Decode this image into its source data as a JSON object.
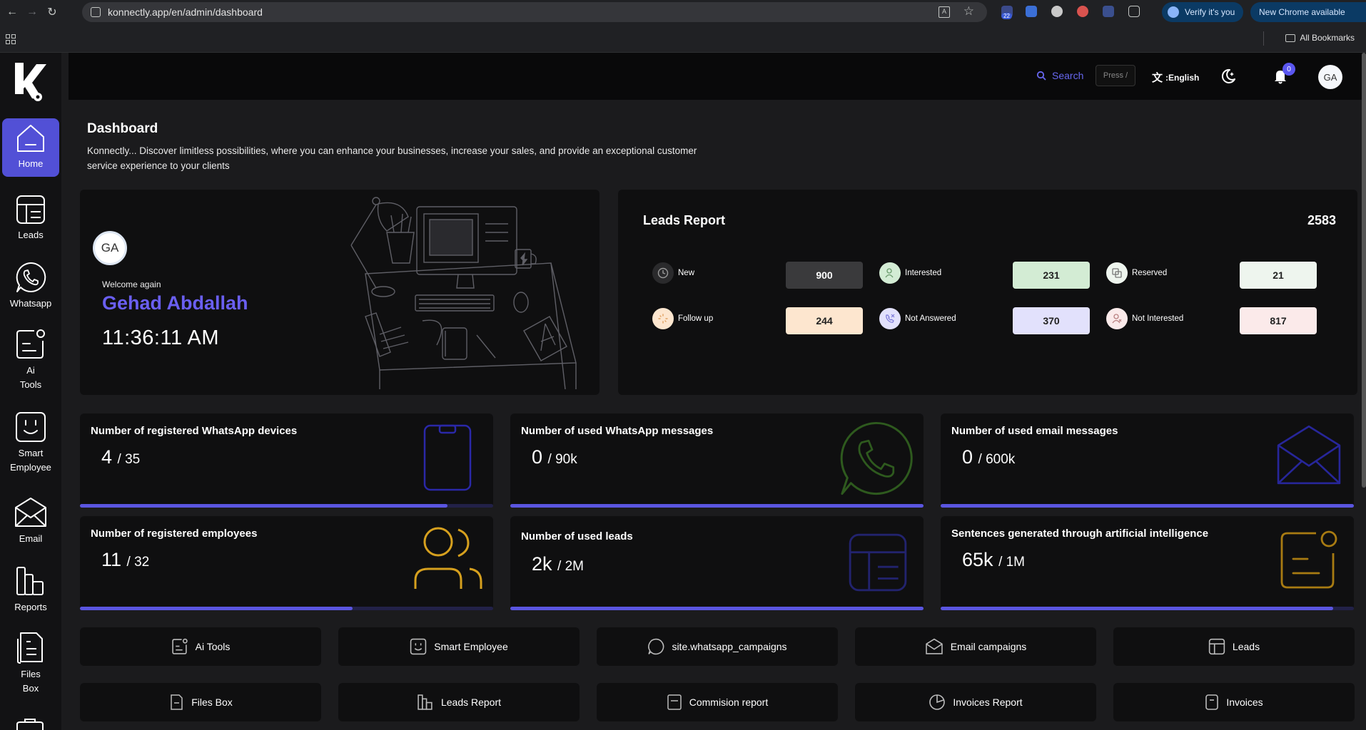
{
  "browser": {
    "url": "konnectly.app/en/admin/dashboard",
    "ext_badge": "22",
    "verify_label": "Verify it's you",
    "update_label": "New Chrome available",
    "bookmarks_label": "All Bookmarks"
  },
  "sidebar": {
    "items": [
      {
        "label": "Home",
        "icon": "home-icon",
        "active": true
      },
      {
        "label": "Leads",
        "icon": "table-icon"
      },
      {
        "label": "Whatsapp",
        "icon": "whatsapp-icon"
      },
      {
        "label": "Ai Tools",
        "icon": "ai-note-icon"
      },
      {
        "label": "Smart Employee",
        "icon": "smile-box-icon"
      },
      {
        "label": "Email",
        "icon": "envelope-icon"
      },
      {
        "label": "Reports",
        "icon": "bar-chart-icon"
      },
      {
        "label": "Files Box",
        "icon": "files-icon"
      }
    ]
  },
  "topbar": {
    "search_label": "Search",
    "search_shortcut": "Press /",
    "language": ":English",
    "notification_count": "0",
    "avatar_initials": "GA"
  },
  "page": {
    "title": "Dashboard",
    "description": "Konnectly... Discover limitless possibilities, where you can enhance your businesses, increase your sales, and provide an exceptional customer service experience to your clients"
  },
  "welcome": {
    "avatar_initials": "GA",
    "greeting": "Welcome again",
    "name": "Gehad Abdallah",
    "time": "11:36:11 AM"
  },
  "leads_report": {
    "title": "Leads Report",
    "total": "2583",
    "items": [
      {
        "label": "New",
        "value": "900",
        "color": "#3a3a3c",
        "text_color": "#ffffff"
      },
      {
        "label": "Interested",
        "value": "231",
        "color": "#d3ecd4",
        "text_color": "#222222"
      },
      {
        "label": "Reserved",
        "value": "21",
        "color": "#eef5ee",
        "text_color": "#222222"
      },
      {
        "label": "Follow up",
        "value": "244",
        "color": "#fde6cf",
        "text_color": "#222222"
      },
      {
        "label": "Not Answered",
        "value": "370",
        "color": "#e2e1fc",
        "text_color": "#222222"
      },
      {
        "label": "Not Interested",
        "value": "817",
        "color": "#fbeaea",
        "text_color": "#222222"
      }
    ]
  },
  "stats": [
    {
      "title": "Number of registered WhatsApp devices",
      "used": "4",
      "total": "/ 35",
      "progress": 0.89,
      "icon": "phone-icon",
      "icon_color": "#2a28a8"
    },
    {
      "title": "Number of used WhatsApp messages",
      "used": "0",
      "total": "/ 90k",
      "progress": 1.0,
      "icon": "whatsapp-icon",
      "icon_color": "#2e5a1e"
    },
    {
      "title": "Number of used email messages",
      "used": "0",
      "total": "/ 600k",
      "progress": 1.0,
      "icon": "envelope-icon",
      "icon_color": "#27269a"
    },
    {
      "title": "Number of registered employees",
      "used": "11",
      "total": "/ 32",
      "progress": 0.66,
      "icon": "users-icon",
      "icon_color": "#d6a01e"
    },
    {
      "title": "Number of used leads",
      "used": "2k",
      "total": "/ 2M",
      "progress": 1.0,
      "icon": "table-icon",
      "icon_color": "#22236e"
    },
    {
      "title": "Sentences generated through artificial intelligence",
      "used": "65k",
      "total": "/ 1M",
      "progress": 0.95,
      "icon": "ai-note-icon",
      "icon_color": "#a87b12"
    }
  ],
  "quick_links": [
    {
      "label": "Ai Tools",
      "icon": "ai-note-icon"
    },
    {
      "label": "Smart Employee",
      "icon": "smile-box-icon"
    },
    {
      "label": "site.whatsapp_campaigns",
      "icon": "whatsapp-icon"
    },
    {
      "label": "Email campaigns",
      "icon": "envelope-icon"
    },
    {
      "label": "Leads",
      "icon": "table-icon"
    },
    {
      "label": "Files Box",
      "icon": "files-icon"
    },
    {
      "label": "Leads Report",
      "icon": "bar-chart-icon"
    },
    {
      "label": "Commision report",
      "icon": "report-icon"
    },
    {
      "label": "Invoices Report",
      "icon": "pie-icon"
    },
    {
      "label": "Invoices",
      "icon": "invoice-icon"
    }
  ],
  "colors": {
    "accent": "#5a55e0",
    "name_color": "#6a5ff2",
    "sidebar_active": "#5250d6"
  }
}
